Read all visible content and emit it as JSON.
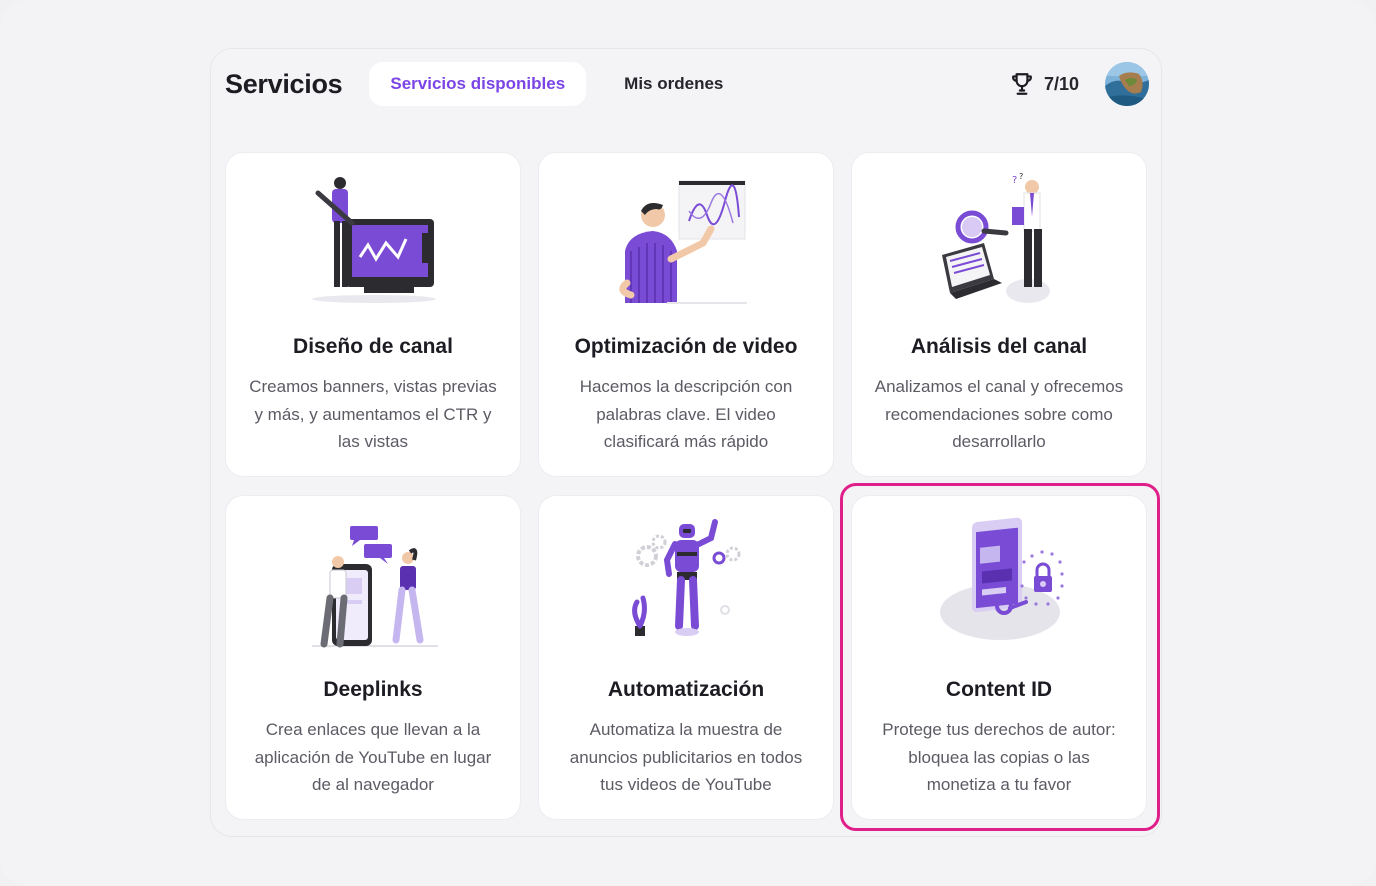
{
  "header": {
    "title": "Servicios",
    "tabs": [
      {
        "label": "Servicios disponibles",
        "active": true
      },
      {
        "label": "Mis ordenes",
        "active": false
      }
    ],
    "score": "7/10",
    "score_icon": "trophy-icon"
  },
  "accent_color": "#7b45e6",
  "highlight_color": "#e0208a",
  "services": [
    {
      "title": "Diseño de canal",
      "description": "Creamos banners, vistas previas y más, y aumentamos el CTR y las vistas",
      "icon": "designer-illustration"
    },
    {
      "title": "Optimización de video",
      "description": "Hacemos la descripción con palabras clave. El video clasificará más rápido",
      "icon": "presenter-chart-illustration"
    },
    {
      "title": "Análisis del canal",
      "description": "Analizamos el canal y ofrecemos recomendaciones sobre como desarrollarlo",
      "icon": "analyst-magnifier-illustration"
    },
    {
      "title": "Deeplinks",
      "description": "Crea enlaces que llevan a la aplicación de YouTube en lugar de al navegador",
      "icon": "people-phone-illustration"
    },
    {
      "title": "Automatización",
      "description": "Automatiza la muestra de anuncios publicitarios en todos tus videos de YouTube",
      "icon": "robot-illustration"
    },
    {
      "title": "Content ID",
      "description": "Protege tus derechos de autor: bloquea las copias o las monetiza a tu favor",
      "icon": "lock-key-illustration"
    }
  ]
}
